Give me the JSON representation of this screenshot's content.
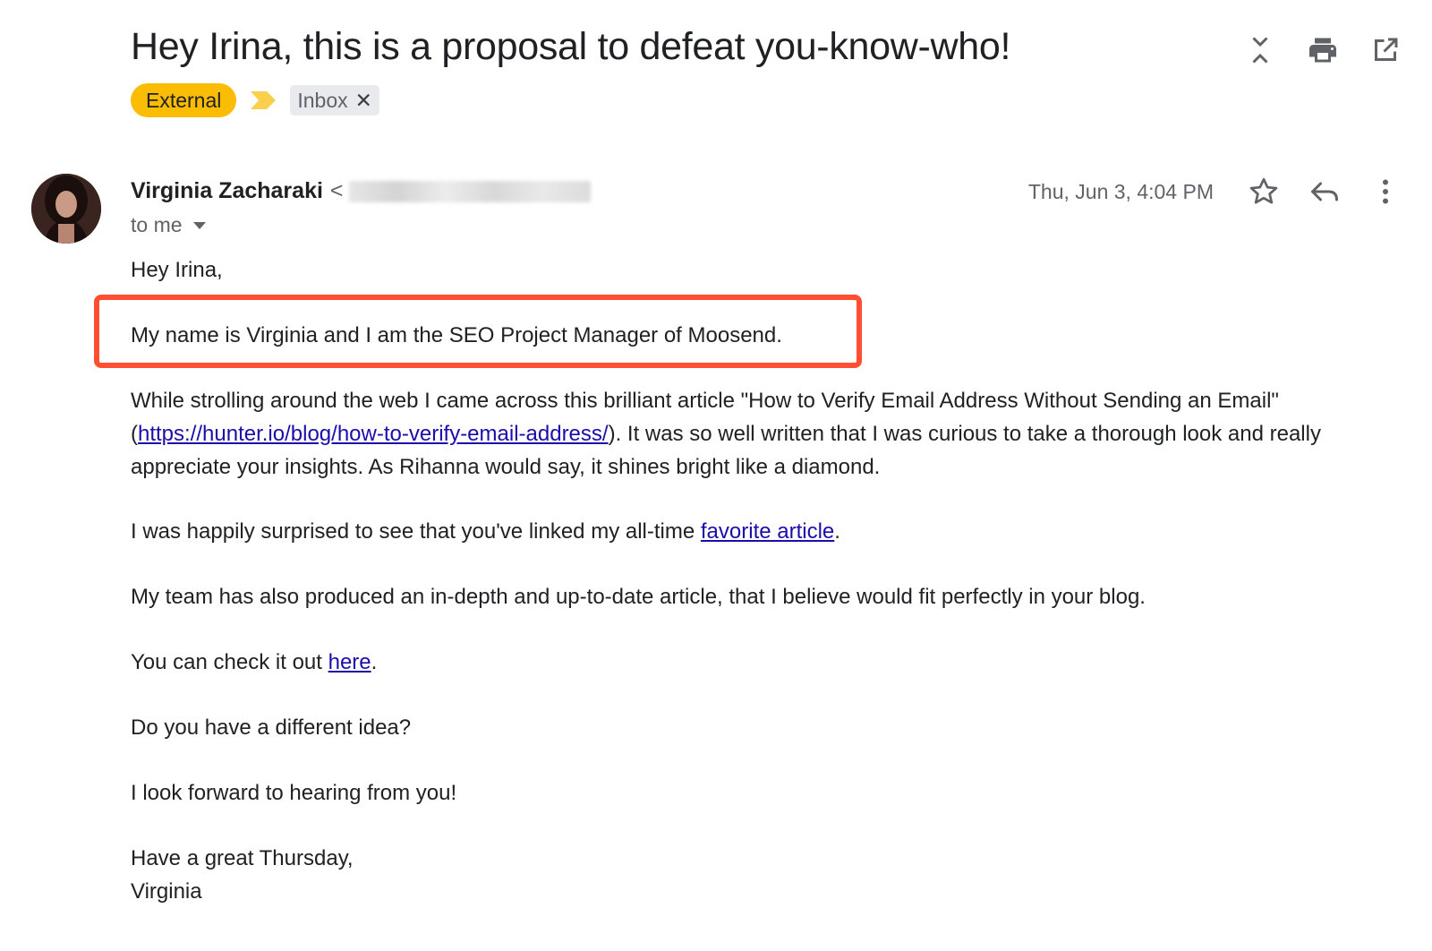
{
  "subject": "Hey Irina, this is a proposal to defeat you-know-who!",
  "labels": {
    "external": "External",
    "inbox": "Inbox",
    "inbox_remove": "✕"
  },
  "sender": {
    "name": "Virginia Zacharaki",
    "email_prefix": "<"
  },
  "recipient": {
    "to_me": "to me"
  },
  "date": "Thu, Jun 3, 4:04 PM",
  "icons": {
    "collapse": "collapse-icon",
    "print": "print-icon",
    "open_new": "open-in-new-window-icon",
    "star": "star-icon",
    "reply": "reply-icon",
    "more": "more-vert-icon",
    "dropdown": "chevron-down-icon"
  },
  "colors": {
    "external_label": "#fbbc04",
    "highlight_border": "#ff4f33",
    "link": "#1a0dab"
  },
  "body": {
    "greeting": "Hey Irina,",
    "intro": "My name is Virginia and I am the SEO Project Manager of Moosend.",
    "para1_line1": "While strolling around the web I came across this brilliant article \"How to Verify Email Address Without Sending an Email\"",
    "para1_open_paren": "(",
    "para1_link": "https://hunter.io/blog/how-to-verify-email-address/",
    "para1_line2_rest": "). It was so well written that I was curious to take a thorough look and really",
    "para1_line3": "appreciate your insights. As Rihanna would say, it shines bright like a diamond.",
    "para2_text": "I was happily surprised to see that you've linked my all-time ",
    "para2_link": "favorite article",
    "para2_end": ".",
    "para3": "My team has also produced an in-depth and up-to-date article, that I believe would fit perfectly in your blog.",
    "para4_text": "You can check it out ",
    "para4_link": "here",
    "para4_end": ".",
    "para5": "Do you have a different idea?",
    "para6": "I look forward to hearing from you!",
    "signoff": "Have a great Thursday,",
    "signature": "Virginia"
  }
}
